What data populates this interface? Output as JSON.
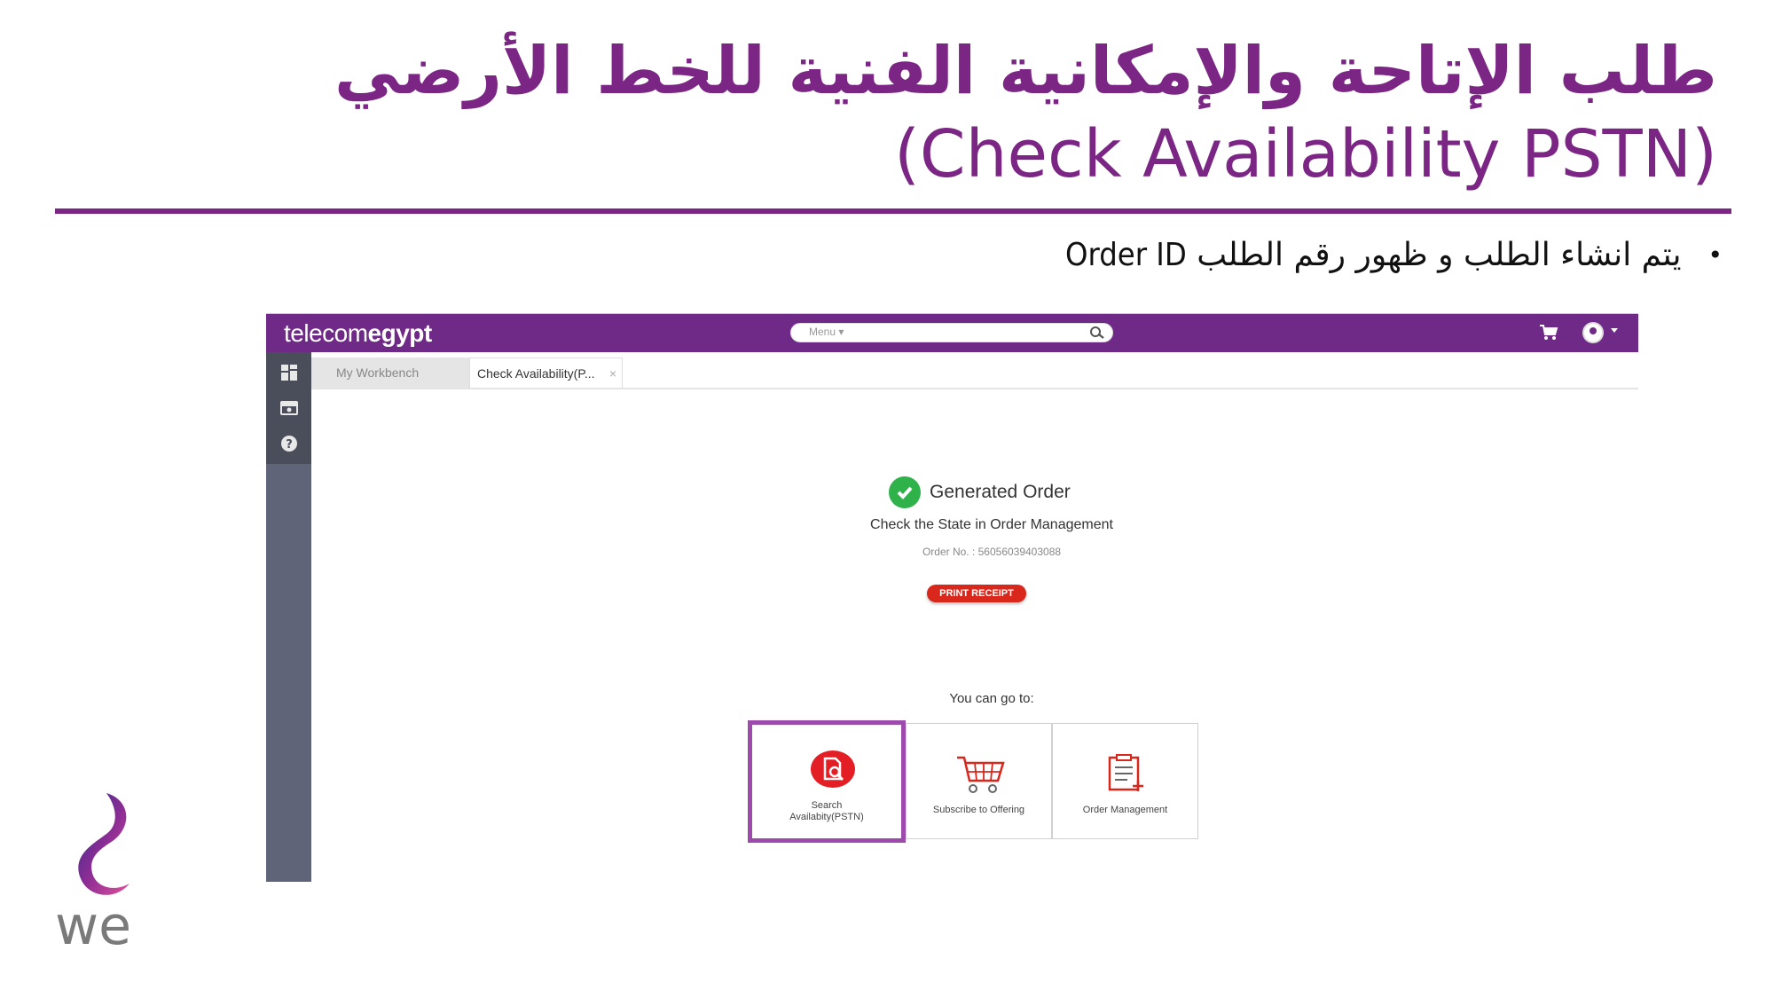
{
  "slide": {
    "title_ar": "طلب الإتاحة والإمكانية الفنية للخط الأرضي",
    "title_en": "(Check Availability PSTN)",
    "bullet_ar": "يتم انشاء الطلب و ظهور رقم الطلب",
    "bullet_en": "Order ID"
  },
  "app": {
    "brand_light": "telecom",
    "brand_bold": "egypt",
    "menu_label": "Menu ▾",
    "tabs": [
      {
        "label": "My Workbench"
      },
      {
        "label": "Check Availability(P..."
      }
    ],
    "tab_close": "×"
  },
  "result": {
    "title": "Generated Order",
    "state_text": "Check the State in Order Management",
    "order_no": "Order No. : 56056039403088",
    "print_button": "PRINT RECEIPT",
    "goto_label": "You can go to:",
    "cards": [
      {
        "label_line1": "Search",
        "label_line2": "Availabity(PSTN)"
      },
      {
        "label": "Subscribe to Offering"
      },
      {
        "label": "Order Management"
      }
    ]
  },
  "logo": {
    "text": "we"
  },
  "colors": {
    "brand_purple": "#6f2a87",
    "title_purple": "#7b2584",
    "highlight": "#9c4aab",
    "success_green": "#2fb24a",
    "print_red": "#d9271c"
  }
}
